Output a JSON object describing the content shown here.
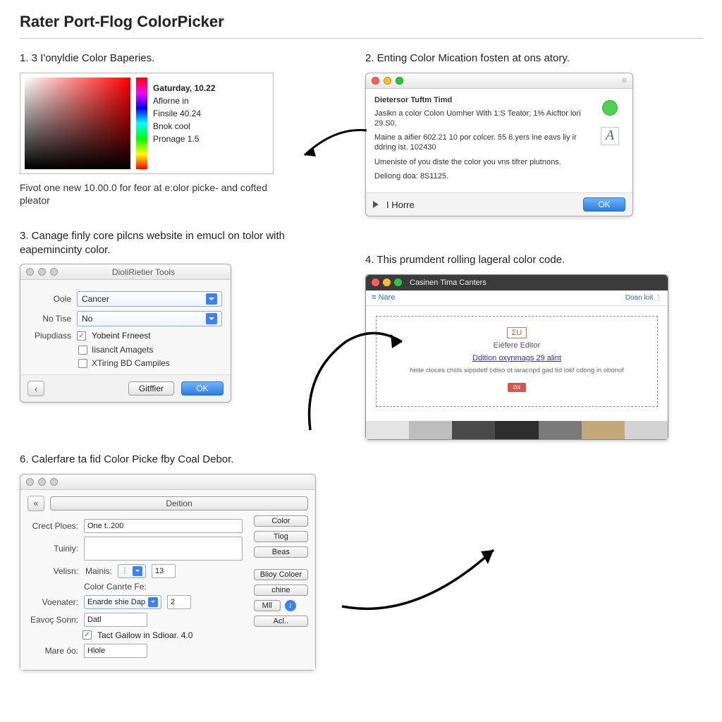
{
  "page_title": "Rater Port-Flog ColorPicker",
  "step1": {
    "title": "1.  3 I'onyldie Color Baperies.",
    "readout": {
      "line1": "Gaturday, 10.22",
      "line2": "Aflorne in",
      "line3": "Finsile 40.24",
      "line4": "Bnok cool",
      "line5": "Pronage 1.5"
    },
    "caption": "Fivot one new 10.00.0 for feor at e:olor picke- and cofted pleator"
  },
  "step2": {
    "title": "2.  Enting Color Mication fosten at ons atory.",
    "window_title": "Dietersor Tuftm Timd",
    "p1": "Jasikn a color Colon Uomher With 1:S Teator; 1% Aicftor lori 29.S0.",
    "p2": "Maine a aifier 602.21 10 por colcer. 55 6.yers ine eavs liy ir ddring ist. 102430",
    "p3": "Umeniste of you diste the color you vns tifrer piutnons.",
    "p4": "Deliong doa: 8S1125.",
    "footer_left": "I Horre",
    "ok": "OK",
    "a_icon": "A"
  },
  "step3": {
    "title": "3.  Canage finly core pilcns website in emucl on tolor with eapemincinty color.",
    "window_title": "DioliRietier Tools",
    "label1": "Oole",
    "select1": "Cancer",
    "label2": "No Tise",
    "select2": "No",
    "label3": "Piupdiass",
    "check1": "Yobeint Frneest",
    "check2": "Iisanclt Amagets",
    "check3": "XTiring BD Campiles",
    "btn1": "Gitffier",
    "btn2": "OK"
  },
  "step4": {
    "title": "4.  This prumdent rolling lageral color code.",
    "window_title": "Casinen Tima Canters",
    "menu": "≡ Nare",
    "toplink": "Doan loit  ⋮",
    "badge": "ΣU",
    "sub": "Eiéfere Editor",
    "link": "Ddition oxynmags 29 alint",
    "desc": "histe cloces chsts sipodetf cdiso ot iaracnpd gad tid lokf cdong in obonof",
    "ok": "ox",
    "swatches": [
      "#e4e4e4",
      "#bdbdbd",
      "#4a4a4a",
      "#2e2e2e",
      "#7a7a7a",
      "#c3a878",
      "#d3d3d3"
    ]
  },
  "step6": {
    "title": "6.  Calerfare ta fid Color Picke fby Coal Debor.",
    "tab": "Deition",
    "labels": {
      "crect": "Crect Ploes:",
      "tuing": "Tuiniy:",
      "velisn": "Velisn:",
      "mains": "Mainis:",
      "colorcarte": "Color Canrte Fe:",
      "voenater": "Voenater:",
      "eavoc": "Eavoç Sonn:",
      "mare": "Mare óo:"
    },
    "values": {
      "crect": "One t..200",
      "voenater_sel": "Enarde shie Dap",
      "voenater_num": "2",
      "eavoc": "Datl",
      "mare": "Hlole",
      "mains_num": "13",
      "tact": "Tact Gailow in Sdioar. 4.0"
    },
    "sidebtns": {
      "color": "Color",
      "tog": "Tiog",
      "beas": "Beas",
      "bloy": "Blioy Coloer",
      "chine": "chine",
      "mal": "Mll",
      "acl": "Acl.. "
    }
  }
}
